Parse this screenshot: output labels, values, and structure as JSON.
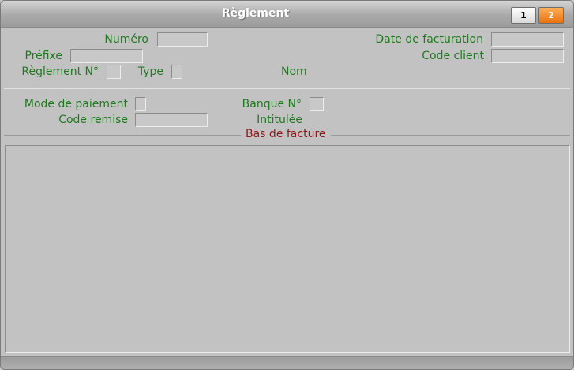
{
  "window": {
    "title": "Règlement"
  },
  "pages": [
    {
      "label": "1"
    },
    {
      "label": "2"
    }
  ],
  "form": {
    "numero": {
      "label": "Numéro",
      "value": ""
    },
    "prefixe": {
      "label": "Préfixe",
      "value": ""
    },
    "reglement_no": {
      "label": "Règlement N°",
      "value": ""
    },
    "type": {
      "label": "Type",
      "value": ""
    },
    "nom": {
      "label": "Nom"
    },
    "date_facturation": {
      "label": "Date de facturation",
      "value": ""
    },
    "code_client": {
      "label": "Code client",
      "value": ""
    },
    "mode_paiement": {
      "label": "Mode de paiement",
      "value": ""
    },
    "code_remise": {
      "label": "Code remise",
      "value": ""
    },
    "banque_no": {
      "label": "Banque N°",
      "value": ""
    },
    "intitulee": {
      "label": "Intitulée"
    }
  },
  "footer_group": {
    "title": "Bas de facture"
  },
  "colors": {
    "label": "#1f7a1f",
    "group_title": "#8b1a1a",
    "active_page": "#e8720e",
    "background": "#c2c2c2"
  }
}
